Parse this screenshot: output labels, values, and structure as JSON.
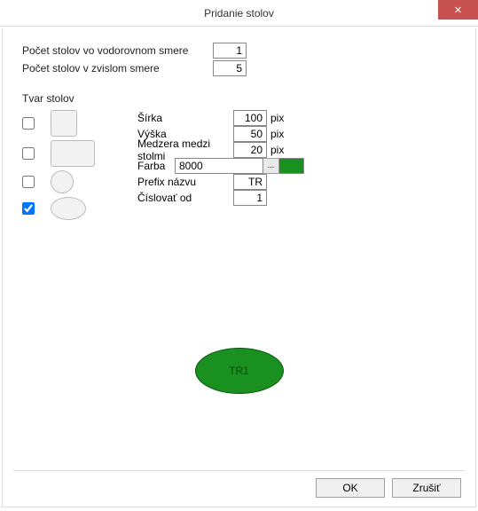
{
  "window": {
    "title": "Pridanie stolov"
  },
  "counts": {
    "horiz_label": "Počet stolov vo vodorovnom smere",
    "horiz_value": "1",
    "vert_label": "Počet stolov v zvislom smere",
    "vert_value": "5"
  },
  "shape_section_label": "Tvar stolov",
  "shapes": {
    "square_checked": false,
    "rect_checked": false,
    "circle_checked": false,
    "ellipse_checked": true
  },
  "props": {
    "width_label": "Šírka",
    "width_value": "100",
    "width_unit": "pix",
    "height_label": "Výška",
    "height_value": "50",
    "height_unit": "pix",
    "gap_label": "Medzera medzi stolmi",
    "gap_value": "20",
    "gap_unit": "pix",
    "color_label": "Farba",
    "color_value": "8000",
    "color_btn": "...",
    "color_hex": "#1a9020",
    "prefix_label": "Prefix názvu",
    "prefix_value": "TR",
    "numfrom_label": "Číslovať od",
    "numfrom_value": "1"
  },
  "preview": {
    "label": "TR1"
  },
  "buttons": {
    "ok": "OK",
    "cancel": "Zrušiť"
  }
}
